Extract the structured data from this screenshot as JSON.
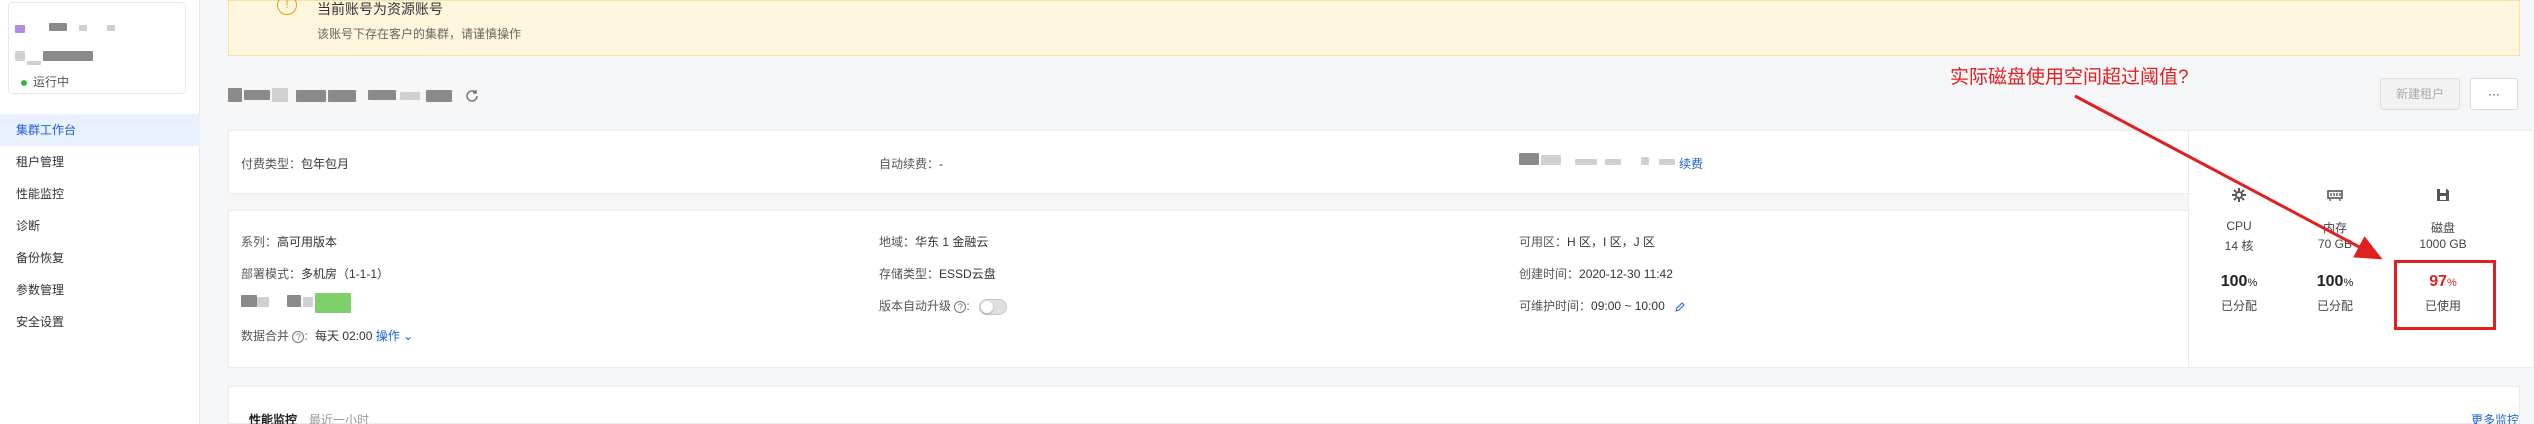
{
  "sidebar": {
    "status": "运行中",
    "items": [
      {
        "label": "集群工作台",
        "active": true
      },
      {
        "label": "租户管理"
      },
      {
        "label": "性能监控"
      },
      {
        "label": "诊断"
      },
      {
        "label": "备份恢复"
      },
      {
        "label": "参数管理"
      },
      {
        "label": "安全设置"
      }
    ]
  },
  "banner": {
    "title": "当前账号为资源账号",
    "desc": "该账号下存在客户的集群，请谨慎操作",
    "icon": "warning-icon"
  },
  "toolbar": {
    "new_tenant": "新建租户",
    "more": "···"
  },
  "billing": {
    "pay_type_label": "付费类型：",
    "pay_type_value": "包年包月",
    "auto_renew_label": "自动续费：",
    "auto_renew_value": "-",
    "renew_link": "续费"
  },
  "info": {
    "series_label": "系列：",
    "series_value": "高可用版本",
    "region_label": "地域：",
    "region_value": "华东 1 金融云",
    "zone_label": "可用区：",
    "zone_value": "H 区，I 区，J 区",
    "deploy_label": "部署模式：",
    "deploy_value": "多机房（1-1-1）",
    "storage_label": "存储类型：",
    "storage_value": "ESSD云盘",
    "created_label": "创建时间：",
    "created_value": "2020-12-30 11:42",
    "auto_upgrade_label": "版本自动升级",
    "maintain_label": "可维护时间：",
    "maintain_value": "09:00 ~ 10:00",
    "merge_label": "数据合并",
    "merge_value": "每天 02:00",
    "merge_action": "操作"
  },
  "resources": [
    {
      "name": "CPU",
      "cap": "14 核",
      "pct": "100",
      "unit": "%",
      "sub": "已分配",
      "icon": "gear-icon"
    },
    {
      "name": "内存",
      "cap": "70 GB",
      "pct": "100",
      "unit": "%",
      "sub": "已分配",
      "icon": "memory-icon"
    },
    {
      "name": "磁盘",
      "cap": "1000 GB",
      "pct": "97",
      "unit": "%",
      "sub": "已使用",
      "icon": "disk-icon"
    }
  ],
  "annotation": "实际磁盘使用空间超过阈值?",
  "perf": {
    "title": "性能监控",
    "sub": "最近一小时",
    "more": "更多监控"
  },
  "colors": {
    "accent": "#1f5fd6",
    "alert": "#e02020",
    "banner_bg": "#fdf6dd"
  }
}
